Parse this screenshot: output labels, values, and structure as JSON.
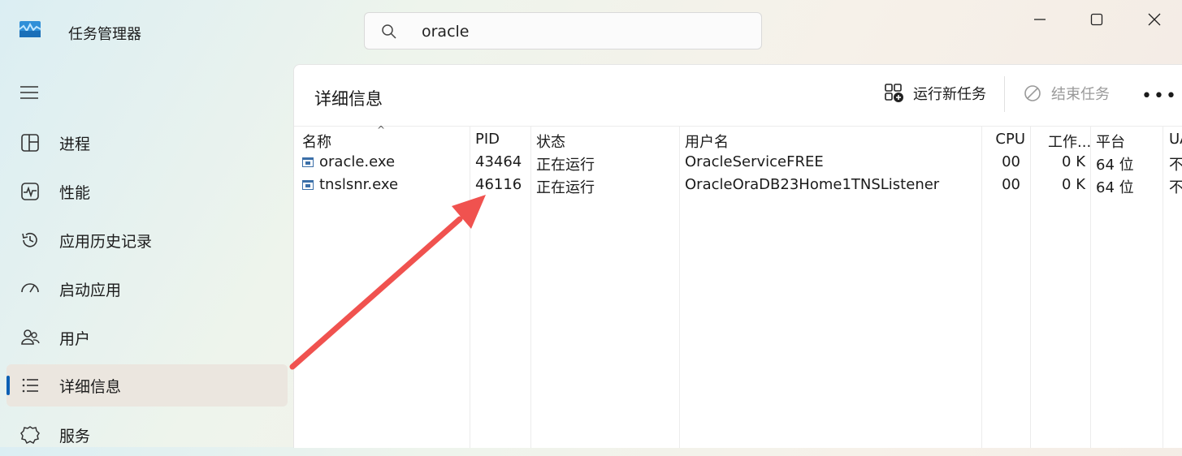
{
  "window": {
    "title": "任务管理器"
  },
  "search": {
    "value": "oracle"
  },
  "sidebar": {
    "items": [
      {
        "label": "进程",
        "icon": "processes-icon"
      },
      {
        "label": "性能",
        "icon": "performance-icon"
      },
      {
        "label": "应用历史记录",
        "icon": "history-icon"
      },
      {
        "label": "启动应用",
        "icon": "startup-icon"
      },
      {
        "label": "用户",
        "icon": "users-icon"
      },
      {
        "label": "详细信息",
        "icon": "details-icon",
        "active": true
      },
      {
        "label": "服务",
        "icon": "services-icon"
      }
    ]
  },
  "panel": {
    "title": "详细信息",
    "run_new_task": "运行新任务",
    "end_task": "结束任务"
  },
  "table": {
    "columns": [
      "名称",
      "PID",
      "状态",
      "用户名",
      "CPU",
      "工作...",
      "平台",
      "UA"
    ],
    "rows": [
      {
        "name": "oracle.exe",
        "pid": "43464",
        "status": "正在运行",
        "user": "OracleServiceFREE",
        "cpu": "00",
        "mem": "0 K",
        "platform": "64 位",
        "ua": "不"
      },
      {
        "name": "tnslsnr.exe",
        "pid": "46116",
        "status": "正在运行",
        "user": "OracleOraDB23Home1TNSListener",
        "cpu": "00",
        "mem": "0 K",
        "platform": "64 位",
        "ua": "不"
      }
    ]
  },
  "colors": {
    "accent": "#0a5fb4",
    "annotation_arrow": "#f0524f"
  }
}
